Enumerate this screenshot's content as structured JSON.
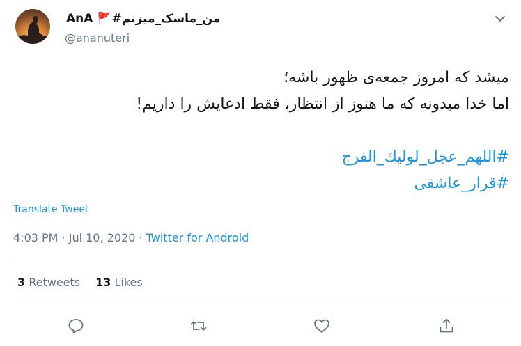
{
  "author": {
    "display_name": "AnA 🚩#من_ماسک_میزنم",
    "username": "@ananuteri"
  },
  "tweet": {
    "lines": [
      "میشد که امروز جمعه‌ی ظهور باشه؛",
      "اما خدا میدونه که ما هنوز از انتظار، فقط ادعایش را داریم!"
    ],
    "hashtags": [
      "#اللهم_عجل_لوليك_الفرج",
      "#قرار_عاشقی"
    ]
  },
  "translate_label": "Translate Tweet",
  "meta": {
    "time": "4:03 PM",
    "sep1": " · ",
    "date": "Jul 10, 2020",
    "sep2": " · ",
    "source": "Twitter for Android"
  },
  "stats": {
    "retweets_count": "3",
    "retweets_label": "Retweets",
    "likes_count": "13",
    "likes_label": "Likes"
  },
  "icons": {
    "reply": "reply-icon",
    "retweet": "retweet-icon",
    "like": "heart-icon",
    "share": "share-icon",
    "caret": "chevron-down-icon"
  },
  "colors": {
    "link": "#1b95e0",
    "secondary_text": "#657786",
    "divider": "#e6ecf0"
  }
}
